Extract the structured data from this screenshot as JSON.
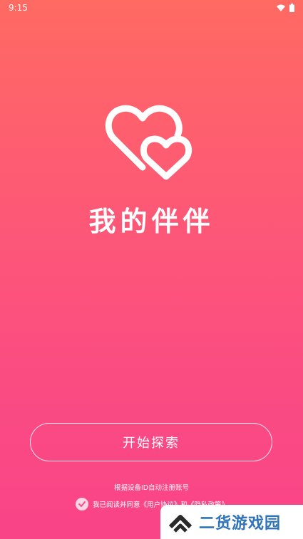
{
  "status_bar": {
    "time": "9:15"
  },
  "app": {
    "title": "我的伴伴"
  },
  "actions": {
    "start_label": "开始探索"
  },
  "hint": {
    "text": "根据设备ID自动注册账号"
  },
  "agreement": {
    "text": "我已阅读并同意《用户协议》和《隐私政策》"
  },
  "watermark": {
    "text": "二货游戏园"
  },
  "colors": {
    "gradient_top": "#ff6a62",
    "gradient_bottom": "#f94488",
    "watermark_blue": "#2f73b8"
  }
}
